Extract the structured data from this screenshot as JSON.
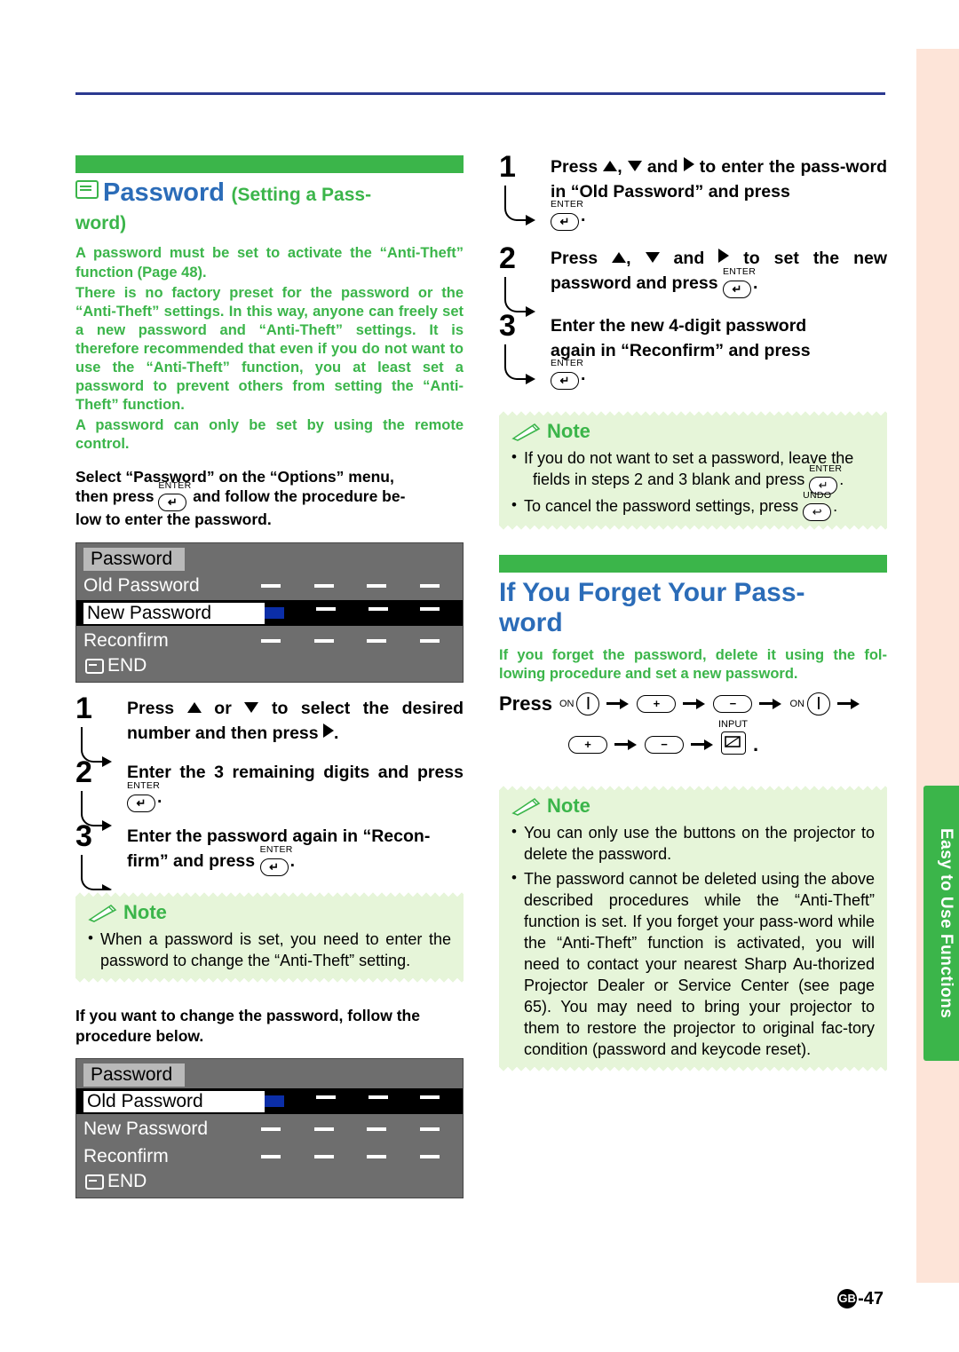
{
  "page": {
    "number_label": "-47",
    "gb_mark": "GB",
    "side_tab_text": "Easy to Use Functions"
  },
  "left": {
    "heading_icon": "square-menu-icon",
    "heading_main": "Password",
    "heading_sub": "(Setting a Pass-",
    "heading_sub2": "word)",
    "green_p1": "A password must be set to activate the “Anti-Theft” function (Page 48).",
    "green_p2": "There is no factory preset for the password or the “Anti-Theft” settings. In this way, anyone can freely set a new password and “Anti-Theft” settings. It is therefore recommended that even if you do not want to use the “Anti-Theft” function, you at least set a password to prevent others from setting the “Anti-Theft” function.",
    "green_p3": "A password can only be set by using the remote control.",
    "intro_a": "Select “Password” on the “Options” menu,",
    "intro_b": "then press",
    "intro_c": "and follow the procedure be-",
    "intro_d": "low to enter the password.",
    "enter_label": "ENTER",
    "osd1": {
      "title": "Password",
      "rows": [
        {
          "name": "Old Password",
          "selected": false,
          "filled_first": false
        },
        {
          "name": "New Password",
          "selected": true,
          "filled_first": true
        },
        {
          "name": "Reconfirm",
          "selected": false,
          "filled_first": false
        }
      ],
      "end_label": "END"
    },
    "steps": [
      {
        "num": "1",
        "text_before": "Press ",
        "text_mid": " or ",
        "text_after": " to select the desired number and then press ",
        "text_end": "."
      },
      {
        "num": "2",
        "text": "Enter the 3 remaining digits and press ",
        "enter": "ENTER"
      },
      {
        "num": "3",
        "text": "Enter the password again in “Recon-firm” and press ",
        "enter": "ENTER"
      }
    ],
    "step1_full": "Press ▲ or ▼ to select the desired number and then press ▶.",
    "step2_full": "Enter the 3 remaining digits and press",
    "step3_a": "Enter the password again in “Recon-",
    "step3_b": "firm” and press",
    "note": {
      "title": "Note",
      "items": [
        "When a password is set, you need to enter the password to change the “Anti-Theft” setting."
      ]
    },
    "change_pw_text": "If you want to change the password, follow the procedure below.",
    "osd2": {
      "title": "Password",
      "rows": [
        {
          "name": "Old Password",
          "selected": true,
          "filled_first": true
        },
        {
          "name": "New Password",
          "selected": false,
          "filled_first": false
        },
        {
          "name": "Reconfirm",
          "selected": false,
          "filled_first": false
        }
      ],
      "end_label": "END"
    }
  },
  "right": {
    "steps": [
      {
        "num": "1",
        "line1": "Press ▲, ▼ and ▶ to enter the pass-",
        "line2": "word in “Old Password” and press",
        "enter": "ENTER",
        "tail": "."
      },
      {
        "num": "2",
        "line1": "Press ▲, ▼ and ▶ to set the new",
        "line2": "password and press",
        "enter": "ENTER",
        "tail": "."
      },
      {
        "num": "3",
        "line1": "Enter the new 4-digit password",
        "line2": "again in “Reconfirm” and press",
        "enter": "ENTER",
        "tail": "."
      }
    ],
    "note1": {
      "title": "Note",
      "item1_a": "If you do not want to set a password, leave the",
      "item1_b": "fields in steps 2 and 3 blank and press",
      "item1_enter": "ENTER",
      "item1_tail": ".",
      "item2_a": "To cancel the password settings, press",
      "item2_undo": "UNDO",
      "item2_tail": "."
    },
    "heading": "If You Forget Your Pass-",
    "heading2": "word",
    "green_p": "If you forget the password, delete it using the fol-lowing procedure and set a new password.",
    "press_label": "Press",
    "button_sequence_row1": [
      "ON",
      "+",
      "−",
      "ON"
    ],
    "button_sequence_row2": [
      "+",
      "−",
      "INPUT"
    ],
    "note2": {
      "title": "Note",
      "items": [
        "You can only use the buttons on the projector to delete the password.",
        "The password cannot be deleted using the above described procedures while the “Anti-Theft” function is set. If you forget your pass-word while the “Anti-Theft” function is activated, you will need to contact your nearest Sharp Au-thorized Projector Dealer or Service Center (see page 65). You may need to bring your projector to them to restore the projector to original fac-tory condition (password and keycode reset)."
      ]
    }
  }
}
